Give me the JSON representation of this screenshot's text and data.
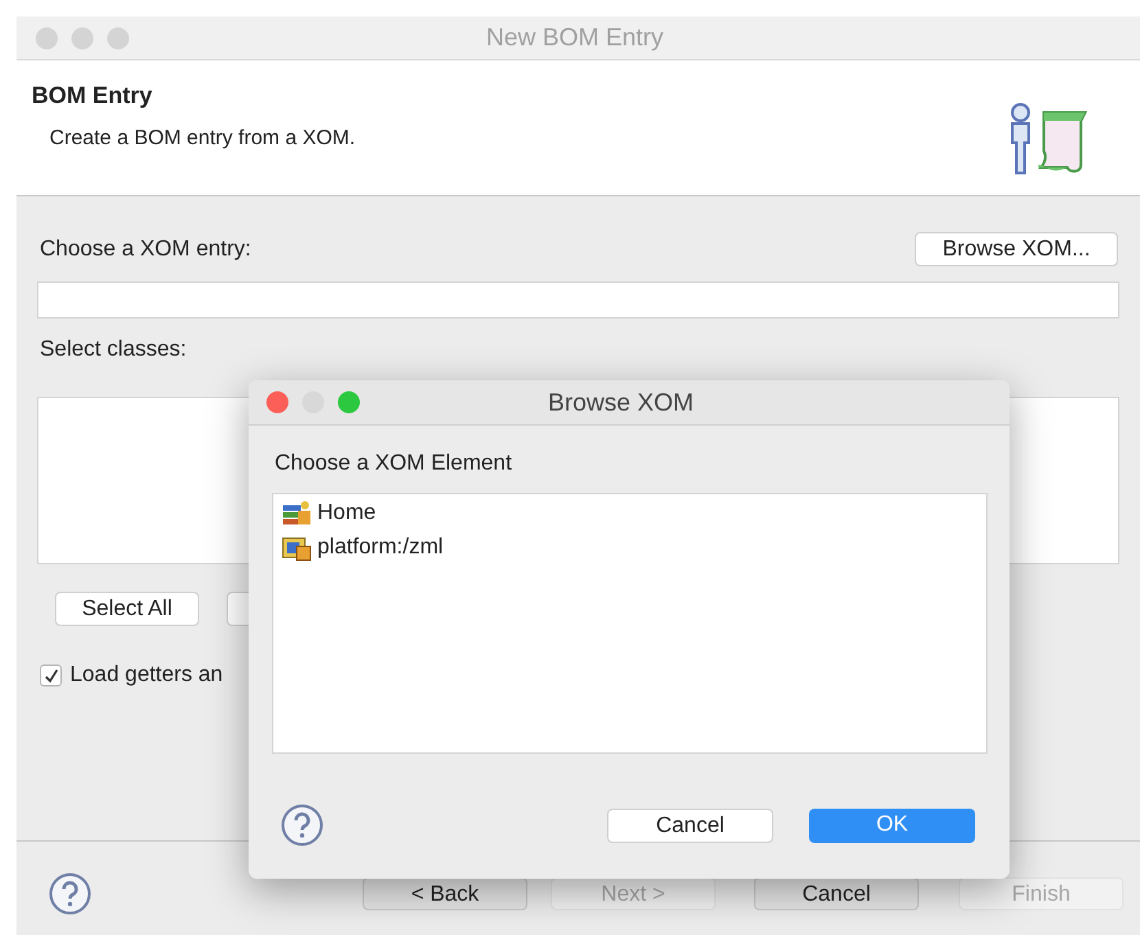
{
  "window": {
    "title": "New BOM Entry"
  },
  "header": {
    "title": "BOM Entry",
    "description": "Create a BOM entry from a XOM."
  },
  "xom_entry": {
    "label": "Choose a XOM entry:",
    "browse_button": "Browse XOM..."
  },
  "classes": {
    "label": "Select classes:",
    "select_all": "Select All"
  },
  "load_getters": {
    "label": "Load getters an",
    "checked": true
  },
  "footer_buttons": [
    {
      "label": "< Back",
      "disabled": false
    },
    {
      "label": "Next >",
      "disabled": true
    },
    {
      "label": "Cancel",
      "disabled": false
    },
    {
      "label": "Finish",
      "disabled": true
    }
  ],
  "dialog": {
    "title": "Browse XOM",
    "label": "Choose a XOM Element",
    "tree": [
      {
        "label": "Home",
        "kind": "project"
      },
      {
        "label": "platform:/zml",
        "kind": "package"
      }
    ],
    "buttons": [
      {
        "label": "Cancel",
        "default": false
      },
      {
        "label": "OK",
        "default": true
      }
    ]
  }
}
